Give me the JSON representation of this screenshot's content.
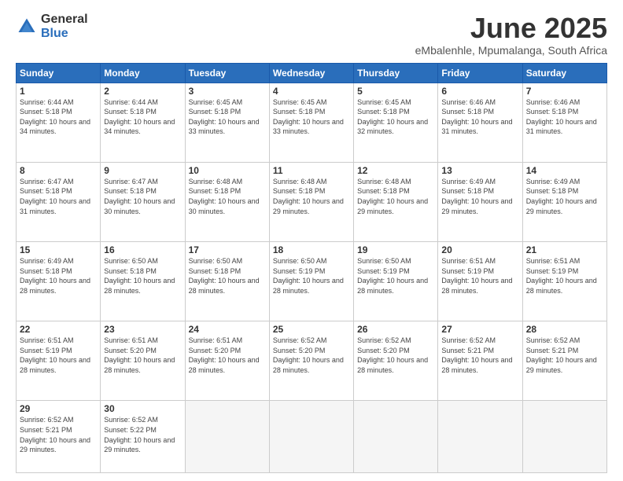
{
  "logo": {
    "general": "General",
    "blue": "Blue"
  },
  "title": "June 2025",
  "subtitle": "eMbalenhle, Mpumalanga, South Africa",
  "weekdays": [
    "Sunday",
    "Monday",
    "Tuesday",
    "Wednesday",
    "Thursday",
    "Friday",
    "Saturday"
  ],
  "weeks": [
    [
      {
        "day": "1",
        "sunrise": "6:44 AM",
        "sunset": "5:18 PM",
        "daylight": "10 hours and 34 minutes."
      },
      {
        "day": "2",
        "sunrise": "6:44 AM",
        "sunset": "5:18 PM",
        "daylight": "10 hours and 34 minutes."
      },
      {
        "day": "3",
        "sunrise": "6:45 AM",
        "sunset": "5:18 PM",
        "daylight": "10 hours and 33 minutes."
      },
      {
        "day": "4",
        "sunrise": "6:45 AM",
        "sunset": "5:18 PM",
        "daylight": "10 hours and 33 minutes."
      },
      {
        "day": "5",
        "sunrise": "6:45 AM",
        "sunset": "5:18 PM",
        "daylight": "10 hours and 32 minutes."
      },
      {
        "day": "6",
        "sunrise": "6:46 AM",
        "sunset": "5:18 PM",
        "daylight": "10 hours and 31 minutes."
      },
      {
        "day": "7",
        "sunrise": "6:46 AM",
        "sunset": "5:18 PM",
        "daylight": "10 hours and 31 minutes."
      }
    ],
    [
      {
        "day": "8",
        "sunrise": "6:47 AM",
        "sunset": "5:18 PM",
        "daylight": "10 hours and 31 minutes."
      },
      {
        "day": "9",
        "sunrise": "6:47 AM",
        "sunset": "5:18 PM",
        "daylight": "10 hours and 30 minutes."
      },
      {
        "day": "10",
        "sunrise": "6:48 AM",
        "sunset": "5:18 PM",
        "daylight": "10 hours and 30 minutes."
      },
      {
        "day": "11",
        "sunrise": "6:48 AM",
        "sunset": "5:18 PM",
        "daylight": "10 hours and 29 minutes."
      },
      {
        "day": "12",
        "sunrise": "6:48 AM",
        "sunset": "5:18 PM",
        "daylight": "10 hours and 29 minutes."
      },
      {
        "day": "13",
        "sunrise": "6:49 AM",
        "sunset": "5:18 PM",
        "daylight": "10 hours and 29 minutes."
      },
      {
        "day": "14",
        "sunrise": "6:49 AM",
        "sunset": "5:18 PM",
        "daylight": "10 hours and 29 minutes."
      }
    ],
    [
      {
        "day": "15",
        "sunrise": "6:49 AM",
        "sunset": "5:18 PM",
        "daylight": "10 hours and 28 minutes."
      },
      {
        "day": "16",
        "sunrise": "6:50 AM",
        "sunset": "5:18 PM",
        "daylight": "10 hours and 28 minutes."
      },
      {
        "day": "17",
        "sunrise": "6:50 AM",
        "sunset": "5:18 PM",
        "daylight": "10 hours and 28 minutes."
      },
      {
        "day": "18",
        "sunrise": "6:50 AM",
        "sunset": "5:19 PM",
        "daylight": "10 hours and 28 minutes."
      },
      {
        "day": "19",
        "sunrise": "6:50 AM",
        "sunset": "5:19 PM",
        "daylight": "10 hours and 28 minutes."
      },
      {
        "day": "20",
        "sunrise": "6:51 AM",
        "sunset": "5:19 PM",
        "daylight": "10 hours and 28 minutes."
      },
      {
        "day": "21",
        "sunrise": "6:51 AM",
        "sunset": "5:19 PM",
        "daylight": "10 hours and 28 minutes."
      }
    ],
    [
      {
        "day": "22",
        "sunrise": "6:51 AM",
        "sunset": "5:19 PM",
        "daylight": "10 hours and 28 minutes."
      },
      {
        "day": "23",
        "sunrise": "6:51 AM",
        "sunset": "5:20 PM",
        "daylight": "10 hours and 28 minutes."
      },
      {
        "day": "24",
        "sunrise": "6:51 AM",
        "sunset": "5:20 PM",
        "daylight": "10 hours and 28 minutes."
      },
      {
        "day": "25",
        "sunrise": "6:52 AM",
        "sunset": "5:20 PM",
        "daylight": "10 hours and 28 minutes."
      },
      {
        "day": "26",
        "sunrise": "6:52 AM",
        "sunset": "5:20 PM",
        "daylight": "10 hours and 28 minutes."
      },
      {
        "day": "27",
        "sunrise": "6:52 AM",
        "sunset": "5:21 PM",
        "daylight": "10 hours and 28 minutes."
      },
      {
        "day": "28",
        "sunrise": "6:52 AM",
        "sunset": "5:21 PM",
        "daylight": "10 hours and 29 minutes."
      }
    ],
    [
      {
        "day": "29",
        "sunrise": "6:52 AM",
        "sunset": "5:21 PM",
        "daylight": "10 hours and 29 minutes."
      },
      {
        "day": "30",
        "sunrise": "6:52 AM",
        "sunset": "5:22 PM",
        "daylight": "10 hours and 29 minutes."
      },
      null,
      null,
      null,
      null,
      null
    ]
  ]
}
